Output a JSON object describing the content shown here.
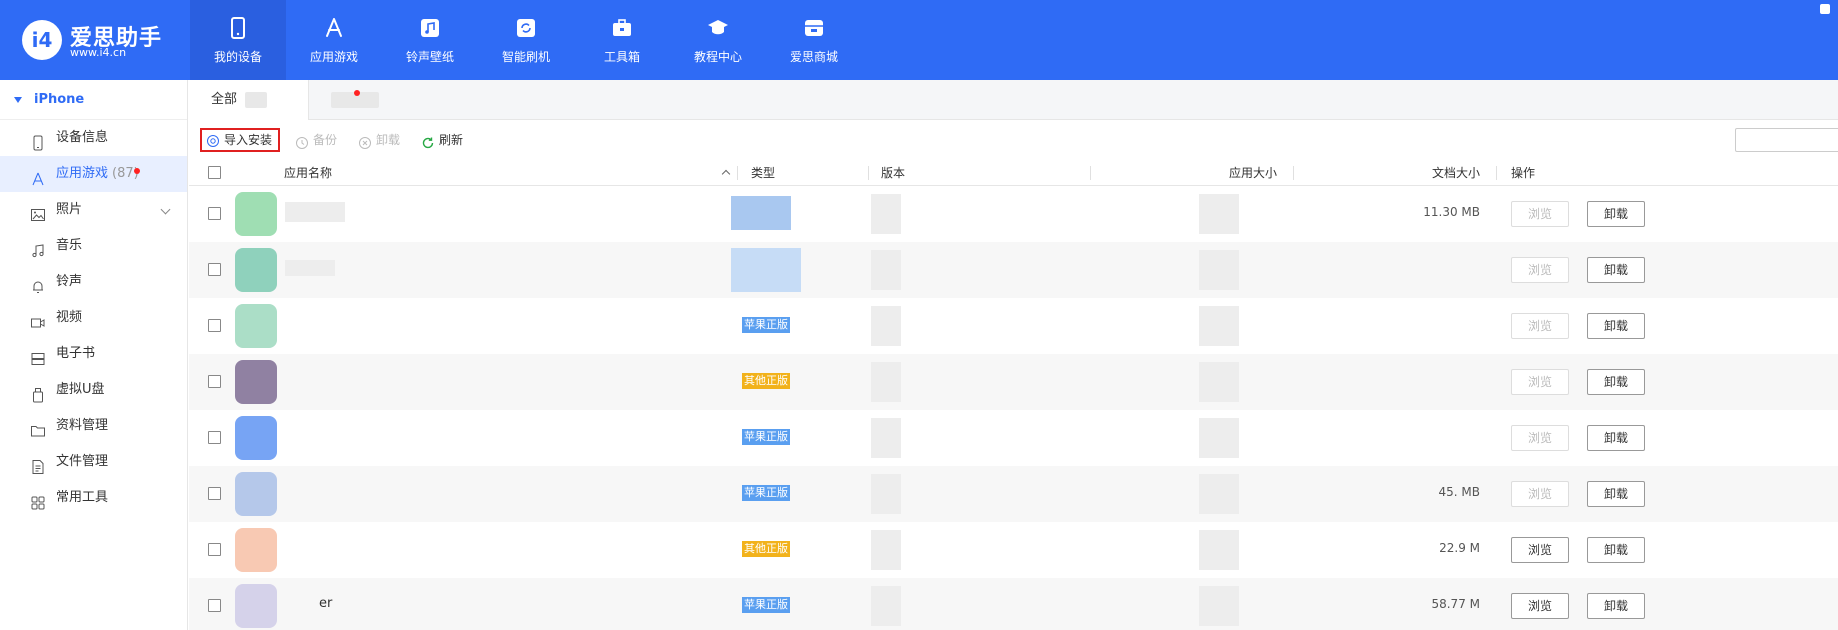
{
  "app": {
    "logo_mark": "i4",
    "name": "爱思助手",
    "url": "www.i4.cn"
  },
  "nav": [
    {
      "label": "我的设备",
      "icon": "phone-icon",
      "active": true
    },
    {
      "label": "应用游戏",
      "icon": "app-store-icon",
      "active": false
    },
    {
      "label": "铃声壁纸",
      "icon": "music-icon",
      "active": false
    },
    {
      "label": "智能刷机",
      "icon": "refresh-box-icon",
      "active": false
    },
    {
      "label": "工具箱",
      "icon": "toolbox-icon",
      "active": false
    },
    {
      "label": "教程中心",
      "icon": "graduation-cap-icon",
      "active": false
    },
    {
      "label": "爱思商城",
      "icon": "shop-icon",
      "active": false
    }
  ],
  "sidebar": {
    "device": "iPhone",
    "items": [
      {
        "label": "设备信息",
        "icon": "device-info-icon"
      },
      {
        "label": "应用游戏",
        "icon": "app-store-icon",
        "count": "(87)",
        "active": true
      },
      {
        "label": "照片",
        "icon": "photo-icon",
        "expandable": true
      },
      {
        "label": "音乐",
        "icon": "music-note-icon"
      },
      {
        "label": "铃声",
        "icon": "bell-icon"
      },
      {
        "label": "视频",
        "icon": "video-icon"
      },
      {
        "label": "电子书",
        "icon": "ebook-icon"
      },
      {
        "label": "虚拟U盘",
        "icon": "usb-drive-icon"
      },
      {
        "label": "资料管理",
        "icon": "folder-icon"
      },
      {
        "label": "文件管理",
        "icon": "file-icon"
      },
      {
        "label": "常用工具",
        "icon": "grid-icon"
      }
    ]
  },
  "tabs": [
    {
      "label": "全部",
      "active": true
    },
    {
      "label": "",
      "active": false
    }
  ],
  "toolbar": {
    "import_label": "导入安装",
    "backup_label": "备份",
    "uninstall_label": "卸载",
    "refresh_label": "刷新"
  },
  "table": {
    "headers": {
      "name": "应用名称",
      "type": "类型",
      "version": "版本",
      "app_size": "应用大小",
      "doc_size": "文档大小",
      "actions": "操作"
    },
    "browse_label": "浏览",
    "uninstall_label": "卸载",
    "rows": [
      {
        "name": "",
        "type": "",
        "doc_size": "11.30 MB",
        "browse_enabled": false,
        "icon_color": "#7fd39a"
      },
      {
        "name": "",
        "type": "",
        "doc_size": "",
        "browse_enabled": false,
        "icon_color": "#6cc4a8"
      },
      {
        "name": "",
        "type": "苹果正版",
        "doc_size": "",
        "browse_enabled": false,
        "icon_color": "#8fd3b4"
      },
      {
        "name": "",
        "type": "其他正版",
        "doc_size": "",
        "browse_enabled": false,
        "icon_color": "#6e5a86"
      },
      {
        "name": "",
        "type": "苹果正版",
        "doc_size": "",
        "browse_enabled": false,
        "icon_color": "#4a86f0"
      },
      {
        "name": "",
        "type": "苹果正版",
        "doc_size": "45. MB",
        "browse_enabled": false,
        "icon_color": "#9fb8e6"
      },
      {
        "name": "",
        "type": "其他正版",
        "doc_size": "22.9 M",
        "browse_enabled": true,
        "icon_color": "#f5b79a"
      },
      {
        "name": "er",
        "type": "苹果正版",
        "doc_size": "58.77 M",
        "browse_enabled": true,
        "icon_color": "#c9c6e6"
      }
    ]
  },
  "colors": {
    "brand": "#2f6bf5",
    "apple_badge": "#5a9ff0",
    "other_badge": "#f2b21b",
    "highlight_border": "#e02020"
  }
}
